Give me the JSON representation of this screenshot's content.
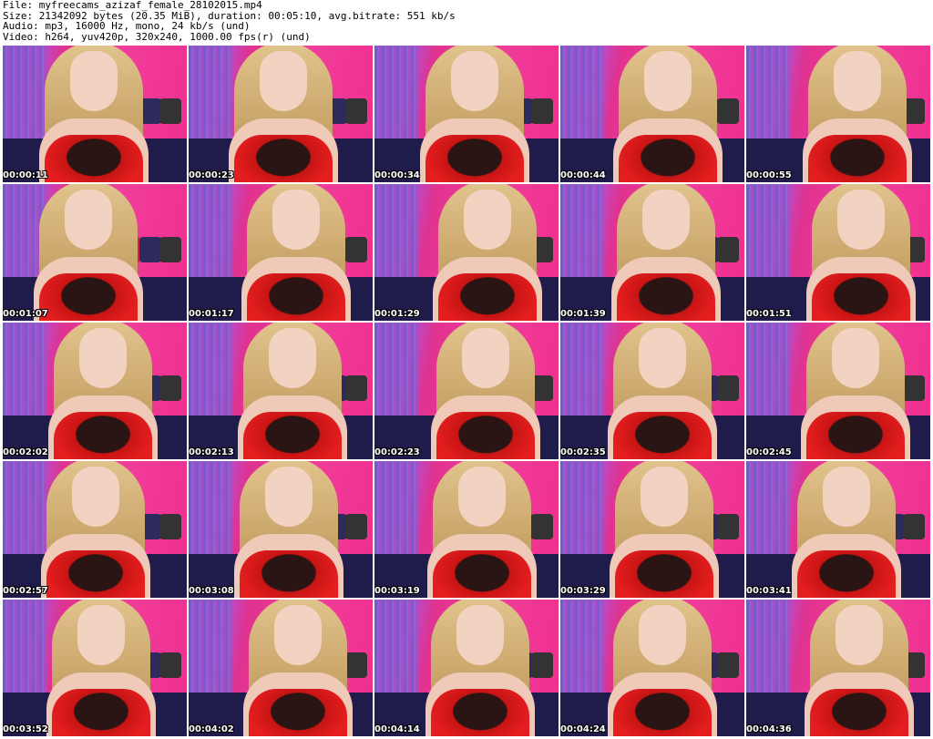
{
  "header": {
    "file_line": "File: myfreecams_azizaf_female_28102015.mp4",
    "size_line": "Size: 21342092 bytes (20.35 MiB), duration: 00:05:10, avg.bitrate: 551 kb/s",
    "audio_line": "Audio: mp3, 16000 Hz, mono, 24 kb/s (und)",
    "video_line": "Video: h264, yuv420p, 320x240, 1000.00 fps(r) (und)"
  },
  "thumbnails": [
    {
      "timestamp": "00:00:11"
    },
    {
      "timestamp": "00:00:23"
    },
    {
      "timestamp": "00:00:34"
    },
    {
      "timestamp": "00:00:44"
    },
    {
      "timestamp": "00:00:55"
    },
    {
      "timestamp": "00:01:07"
    },
    {
      "timestamp": "00:01:17"
    },
    {
      "timestamp": "00:01:29"
    },
    {
      "timestamp": "00:01:39"
    },
    {
      "timestamp": "00:01:51"
    },
    {
      "timestamp": "00:02:02"
    },
    {
      "timestamp": "00:02:13"
    },
    {
      "timestamp": "00:02:23"
    },
    {
      "timestamp": "00:02:35"
    },
    {
      "timestamp": "00:02:45"
    },
    {
      "timestamp": "00:02:57"
    },
    {
      "timestamp": "00:03:08"
    },
    {
      "timestamp": "00:03:19"
    },
    {
      "timestamp": "00:03:29"
    },
    {
      "timestamp": "00:03:41"
    },
    {
      "timestamp": "00:03:52"
    },
    {
      "timestamp": "00:04:02"
    },
    {
      "timestamp": "00:04:14"
    },
    {
      "timestamp": "00:04:24"
    },
    {
      "timestamp": "00:04:36"
    }
  ],
  "colors": {
    "background": "#ffffff",
    "wall_pink": "#f02e8e",
    "curtain_purple": "#8d64d6",
    "dress_red": "#e41e1e",
    "timestamp_text": "#ffffff"
  }
}
